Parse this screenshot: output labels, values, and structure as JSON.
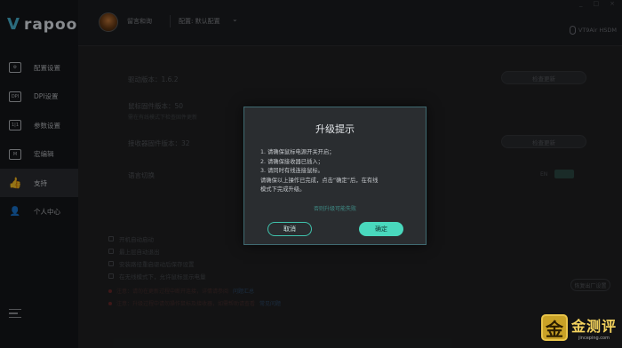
{
  "brand": {
    "logo_mark": "V",
    "logo_text": "rapoo"
  },
  "sidebar": {
    "items": [
      {
        "label": "配置设置",
        "icon": "profile-icon",
        "glyph": "⚙"
      },
      {
        "label": "DPI设置",
        "icon": "dpi-icon",
        "glyph": "DPI"
      },
      {
        "label": "参数设置",
        "icon": "params-icon",
        "glyph": "1|1"
      },
      {
        "label": "宏编辑",
        "icon": "macro-icon",
        "glyph": "M"
      },
      {
        "label": "支持",
        "icon": "thumbs-up-icon",
        "glyph": "👍"
      },
      {
        "label": "个人中心",
        "icon": "user-icon",
        "glyph": "👤"
      }
    ],
    "active_index": 4
  },
  "header": {
    "username": "留言和询",
    "config_label": "配置: 默认配置",
    "config_caret": "⌄",
    "device_name": "VT9Air HSDM",
    "window_controls": [
      "_",
      "□",
      "×"
    ]
  },
  "content": {
    "driver_version": "驱动版本：1.6.2",
    "check_update_1": "检查更新",
    "mouse_firmware": "鼠标固件版本：50",
    "mouse_firmware_sub": "需在有线模式下检查固件更新",
    "receiver_firmware": "接收器固件版本：32",
    "check_update_2": "检查更新",
    "language": "语言切换",
    "lang_a": "EN",
    "options": [
      "开机自动启动",
      "最上层自动退出",
      "安装路径重启驱动后保存设置",
      "在无线模式下，允许鼠标显示电量"
    ],
    "notes": [
      {
        "text": "注意：请勿在更新过程中断开连接，详情请参阅",
        "link": "问题汇总"
      },
      {
        "text": "注意：升级过程中请勿操作鼠标及接收器，如需帮助请查看",
        "link": "常见问题"
      }
    ],
    "reset_label": "恢复出厂设置"
  },
  "dialog": {
    "title": "升级提示",
    "lines": [
      "1. 请确保鼠标电源开关开启；",
      "2. 请确保接收器已插入；",
      "3. 请同时有线连接鼠标。",
      "请确保以上操作已完成，点击“确定”后，在有线",
      "模式下完成升级。"
    ],
    "warning": "否则升级可能失败",
    "cancel_label": "取消",
    "ok_label": "确定"
  },
  "watermark": {
    "seal": "金",
    "main": "金测评",
    "sub": "jinceping.com"
  },
  "colors": {
    "accent": "#49d8bd",
    "brand": "#4ab9d8",
    "active_icon": "#3a7ad1",
    "seal": "#c9a227"
  }
}
